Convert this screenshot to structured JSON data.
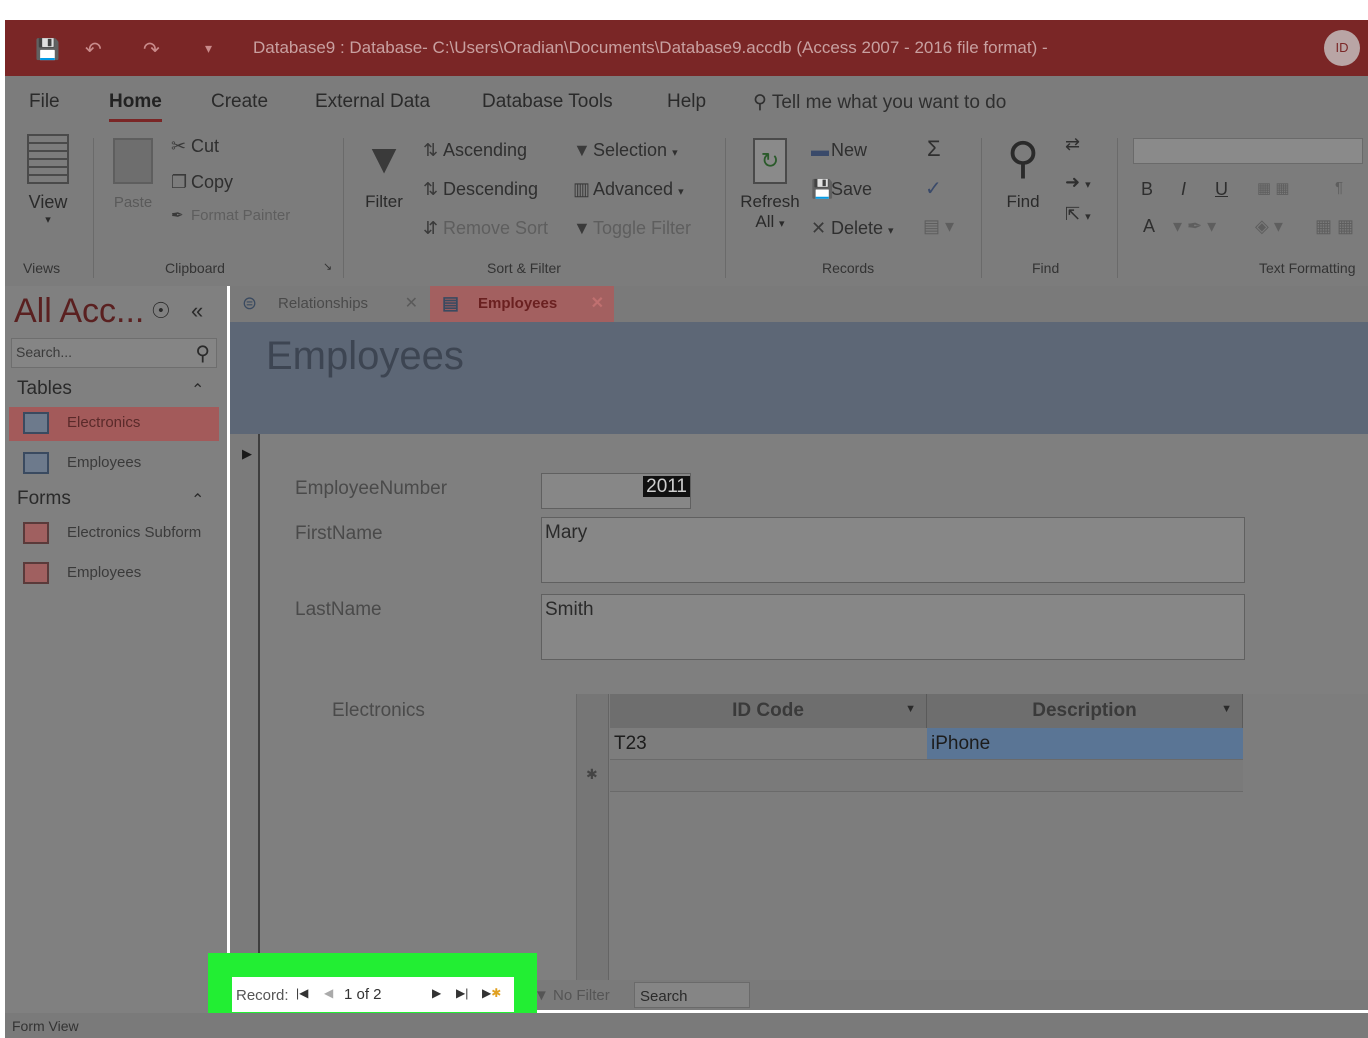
{
  "titlebar": {
    "save_icon": "save-icon",
    "undo_icon": "undo-icon",
    "redo_icon": "redo-icon",
    "customize_icon": "customize-quick-access-icon",
    "title": "Database9 : Database- C:\\Users\\Oradian\\Documents\\Database9.accdb (Access 2007 - 2016 file format)  -",
    "user_initials": "ID"
  },
  "ribbon": {
    "tabs": [
      "File",
      "Home",
      "Create",
      "External Data",
      "Database Tools",
      "Help"
    ],
    "active_tab": "Home",
    "tell_me": "Tell me what you want to do",
    "views": {
      "view_label": "View",
      "group_label": "Views"
    },
    "clipboard": {
      "paste": "Paste",
      "cut": "Cut",
      "copy": "Copy",
      "format_painter": "Format Painter",
      "group_label": "Clipboard"
    },
    "sort_filter": {
      "filter": "Filter",
      "ascending": "Ascending",
      "descending": "Descending",
      "remove_sort": "Remove Sort",
      "selection": "Selection",
      "advanced": "Advanced",
      "toggle_filter": "Toggle Filter",
      "group_label": "Sort & Filter"
    },
    "records": {
      "refresh": "Refresh",
      "refresh_all": "All",
      "new": "New",
      "save": "Save",
      "delete": "Delete",
      "group_label": "Records"
    },
    "find": {
      "find": "Find",
      "group_label": "Find"
    },
    "text_formatting": {
      "bold": "B",
      "italic": "I",
      "underline": "U",
      "font_color": "A",
      "group_label": "Text Formatting"
    }
  },
  "nav": {
    "title": "All Acc...",
    "search_placeholder": "Search...",
    "sections": [
      {
        "label": "Tables",
        "items": [
          {
            "label": "Electronics",
            "selected": true
          },
          {
            "label": "Employees",
            "selected": false
          }
        ]
      },
      {
        "label": "Forms",
        "items": [
          {
            "label": "Electronics Subform",
            "selected": false
          },
          {
            "label": "Employees",
            "selected": false
          }
        ]
      }
    ]
  },
  "doc_tabs": [
    {
      "label": "Relationships",
      "active": false
    },
    {
      "label": "Employees",
      "active": true
    }
  ],
  "form": {
    "title": "Employees",
    "fields": {
      "employee_number": {
        "label": "EmployeeNumber",
        "value": "2011"
      },
      "first_name": {
        "label": "FirstName",
        "value": "Mary"
      },
      "last_name": {
        "label": "LastName",
        "value": "Smith"
      }
    },
    "subform": {
      "label": "Electronics",
      "columns": [
        "ID Code",
        "Description"
      ],
      "rows": [
        [
          "T23",
          "iPhone"
        ]
      ],
      "new_row_marker": "✱",
      "nav": {
        "no_filter": "No Filter",
        "search": "Search"
      }
    },
    "record_nav": {
      "label": "Record:",
      "current": "1 of 2"
    }
  },
  "status": {
    "view": "Form View"
  },
  "colors": {
    "title_bar": "#7a2626",
    "highlight": "#22ee33",
    "selected_cell": "#5a7595"
  }
}
